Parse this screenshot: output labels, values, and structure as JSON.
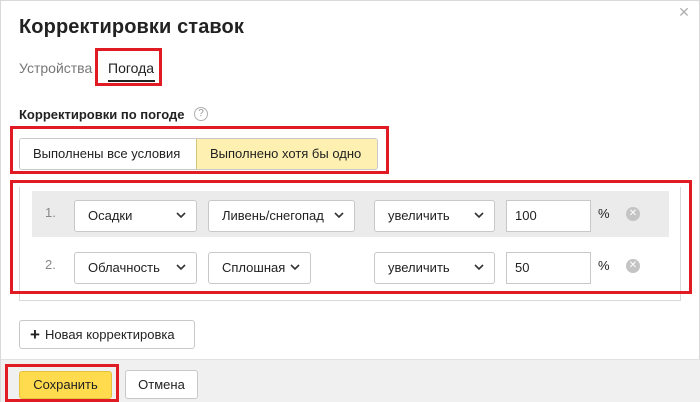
{
  "dialog": {
    "title": "Корректировки ставок",
    "close_icon": "close-icon"
  },
  "tabs": [
    {
      "label": "Устройства",
      "active": false
    },
    {
      "label": "Погода",
      "active": true
    }
  ],
  "section": {
    "title": "Корректировки по погоде",
    "help_icon": "question-circle-icon"
  },
  "condition_mode": {
    "options": [
      "Выполнены все условия",
      "Выполнено хотя бы одно"
    ],
    "selected": "Выполнено хотя бы одно"
  },
  "rows": [
    {
      "number": "1.",
      "parameter": "Осадки",
      "value": "Ливень/снегопад",
      "action": "увеличить",
      "percent": "100",
      "unit": "%"
    },
    {
      "number": "2.",
      "parameter": "Облачность",
      "value": "Сплошная",
      "action": "увеличить",
      "percent": "50",
      "unit": "%"
    }
  ],
  "add_button": {
    "icon": "plus-icon",
    "label": "Новая корректировка"
  },
  "footer": {
    "save_label": "Сохранить",
    "cancel_label": "Отмена"
  },
  "colors": {
    "highlight_border": "#e01b24",
    "selected_segment": "#fdf0b0",
    "save_button": "#ffdb4d",
    "active_row_bg": "#ebebeb"
  }
}
